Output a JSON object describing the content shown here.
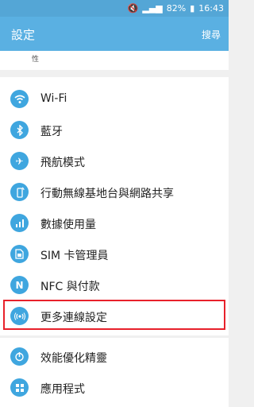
{
  "status_bar": {
    "battery": "82%",
    "time": "16:43"
  },
  "app_bar": {
    "title": "設定",
    "search_label": "搜尋"
  },
  "tabs": [
    {
      "label_line1": "",
      "label_line2": "性"
    }
  ],
  "settings": [
    {
      "id": "wifi",
      "label": "Wi-Fi",
      "icon": "wifi-icon"
    },
    {
      "id": "bluetooth",
      "label": "藍牙",
      "icon": "bluetooth-icon"
    },
    {
      "id": "airplane",
      "label": "飛航模式",
      "icon": "airplane-icon"
    },
    {
      "id": "hotspot",
      "label": "行動無線基地台與網路共享",
      "icon": "hotspot-icon"
    },
    {
      "id": "data",
      "label": "數據使用量",
      "icon": "data-usage-icon"
    },
    {
      "id": "sim",
      "label": "SIM 卡管理員",
      "icon": "sim-card-icon"
    },
    {
      "id": "nfc",
      "label": "NFC 與付款",
      "icon": "nfc-icon"
    },
    {
      "id": "more",
      "label": "更多連線設定",
      "icon": "antenna-icon"
    }
  ],
  "settings2": [
    {
      "id": "power",
      "label": "效能優化精靈",
      "icon": "power-icon"
    },
    {
      "id": "apps",
      "label": "應用程式",
      "icon": "apps-grid-icon"
    }
  ],
  "colors": {
    "accent": "#3fa6df",
    "app_bar": "#5ab0e2",
    "highlight": "#e8212b"
  }
}
